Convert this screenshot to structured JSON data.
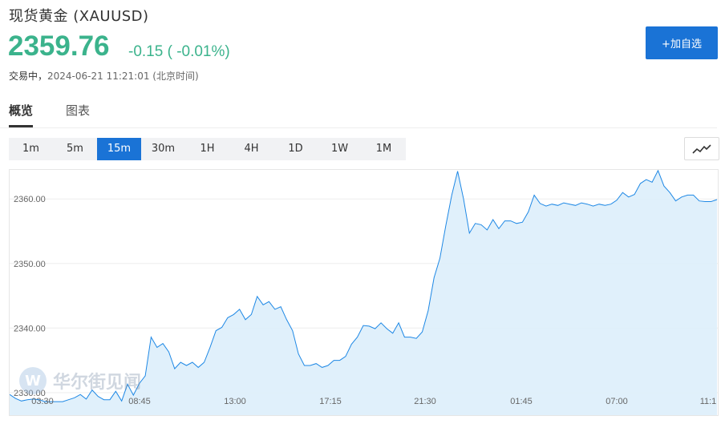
{
  "header": {
    "title": "现货黄金  (XAUUSD)",
    "price": "2359.76",
    "change": "-0.15 ( -0.01%)",
    "status_label": "交易中，",
    "timestamp": "2024-06-21 11:21:01 (北京时间)",
    "watchlist_button": "+加自选"
  },
  "tabs": [
    {
      "label": "概览",
      "active": true
    },
    {
      "label": "图表",
      "active": false
    }
  ],
  "periods": [
    {
      "label": "1m",
      "active": false
    },
    {
      "label": "5m",
      "active": false
    },
    {
      "label": "15m",
      "active": true
    },
    {
      "label": "30m",
      "active": false
    },
    {
      "label": "1H",
      "active": false
    },
    {
      "label": "4H",
      "active": false
    },
    {
      "label": "1D",
      "active": false
    },
    {
      "label": "1W",
      "active": false
    },
    {
      "label": "1M",
      "active": false
    }
  ],
  "chart_type_icon": "line-chart-icon",
  "watermark": {
    "text": "华尔街见闻"
  },
  "colors": {
    "accent": "#1a73d6",
    "price": "#3bb38c",
    "line": "#1e88e5",
    "area": "#ddeefb"
  },
  "chart_data": {
    "type": "area",
    "title": "",
    "xlabel": "",
    "ylabel": "",
    "ylim": [
      2326.5,
      2364.5
    ],
    "y_ticks": [
      "2330.00",
      "2340.00",
      "2350.00",
      "2360.00"
    ],
    "x_ticks": [
      "03:30",
      "08:45",
      "13:00",
      "17:15",
      "21:30",
      "01:45",
      "07:00",
      "11:1"
    ],
    "series": [
      {
        "values": [
          2329.7,
          2329.1,
          2328.7,
          2328.9,
          2329.0,
          2328.9,
          2328.6,
          2328.6,
          2328.6,
          2328.6,
          2328.9,
          2329.2,
          2329.7,
          2329.0,
          2330.4,
          2329.4,
          2328.9,
          2328.9,
          2330.2,
          2328.7,
          2331.3,
          2329.6,
          2331.4,
          2332.6,
          2338.6,
          2337.0,
          2337.6,
          2336.3,
          2333.7,
          2334.7,
          2334.2,
          2334.7,
          2333.9,
          2334.7,
          2337.0,
          2339.6,
          2340.1,
          2341.6,
          2342.1,
          2342.9,
          2341.3,
          2342.1,
          2344.9,
          2343.6,
          2344.1,
          2342.9,
          2343.3,
          2341.3,
          2339.6,
          2336.0,
          2334.2,
          2334.2,
          2334.5,
          2333.9,
          2334.2,
          2335.0,
          2335.0,
          2335.6,
          2337.5,
          2338.6,
          2340.4,
          2340.3,
          2339.9,
          2340.8,
          2339.9,
          2339.2,
          2340.8,
          2338.6,
          2338.6,
          2338.4,
          2339.4,
          2342.7,
          2347.8,
          2350.8,
          2355.9,
          2360.6,
          2364.3,
          2360.0,
          2354.7,
          2356.2,
          2356.0,
          2355.2,
          2356.8,
          2355.4,
          2356.6,
          2356.6,
          2356.2,
          2356.4,
          2358.0,
          2360.6,
          2359.3,
          2358.9,
          2359.2,
          2359.0,
          2359.4,
          2359.2,
          2359.0,
          2359.4,
          2359.2,
          2358.9,
          2359.2,
          2359.0,
          2359.2,
          2359.8,
          2361.0,
          2360.3,
          2360.7,
          2362.4,
          2363.0,
          2362.6,
          2364.4,
          2362.0,
          2361.0,
          2359.7,
          2360.3,
          2360.6,
          2360.6,
          2359.7,
          2359.6,
          2359.6,
          2359.9
        ]
      }
    ],
    "grid": true,
    "legend": "none"
  }
}
